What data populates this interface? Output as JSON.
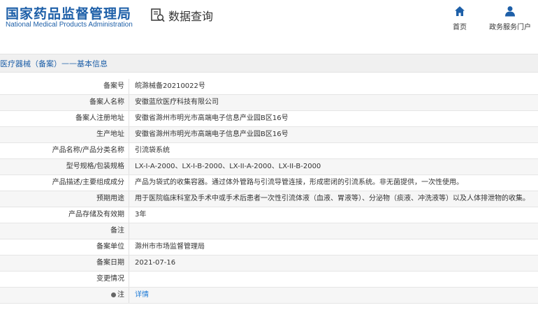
{
  "header": {
    "logo_cn": "国家药品监督管理局",
    "logo_en": "National Medical Products Administration",
    "query_title": "数据查询",
    "nav": [
      {
        "label": "首页",
        "icon": "home-icon"
      },
      {
        "label": "政务服务门户",
        "icon": "user-icon"
      }
    ]
  },
  "breadcrumb": {
    "section": "医疗器械（备案）",
    "separator": "——",
    "page": "基本信息"
  },
  "rows": [
    {
      "label": "备案号",
      "value": "皖滁械备20210022号"
    },
    {
      "label": "备案人名称",
      "value": "安徽蓝欣医疗科技有限公司"
    },
    {
      "label": "备案人注册地址",
      "value": "安徽省滁州市明光市高端电子信息产业园B区16号"
    },
    {
      "label": "生产地址",
      "value": "安徽省滁州市明光市高端电子信息产业园B区16号"
    },
    {
      "label": "产品名称/产品分类名称",
      "value": "引流袋系统"
    },
    {
      "label": "型号规格/包装规格",
      "value": "LX-I-A-2000、LX-I-B-2000、LX-II-A-2000、LX-II-B-2000"
    },
    {
      "label": "产品描述/主要组成成分",
      "value": "产品为袋式的收集容器。通过体外管路与引流导管连接，形成密闭的引流系统。非无菌提供，一次性使用。"
    },
    {
      "label": "预期用途",
      "value": "用于医院临床科室及手术中或手术后患者一次性引流体液（血液、胃液等）、分泌物（痰液、冲洗液等）以及人体排泄物的收集。"
    },
    {
      "label": "产品存储及有效期",
      "value": "3年"
    },
    {
      "label": "备注",
      "value": ""
    },
    {
      "label": "备案单位",
      "value": "滁州市市场监督管理局"
    },
    {
      "label": "备案日期",
      "value": "2021-07-16"
    },
    {
      "label": "变更情况",
      "value": ""
    },
    {
      "label": "注",
      "value": "详情"
    }
  ],
  "colors": {
    "brand_blue": "#1d5fa8",
    "link_blue": "#1d7ad6"
  }
}
